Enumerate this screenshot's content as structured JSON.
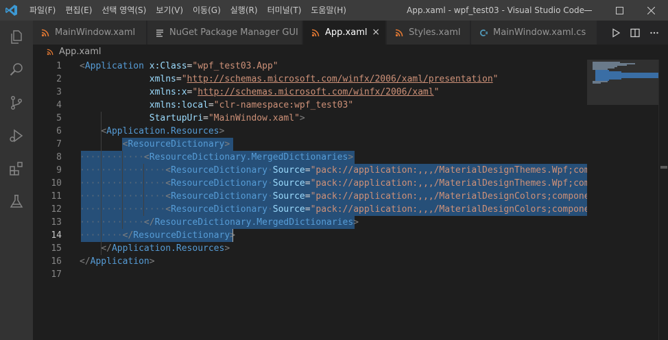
{
  "window": {
    "menu": [
      "파일(F)",
      "편집(E)",
      "선택 영역(S)",
      "보기(V)",
      "이동(G)",
      "실행(R)",
      "터미널(T)",
      "도움말(H)"
    ],
    "title": "App.xaml - wpf_test03 - Visual Studio Code"
  },
  "tabs": [
    {
      "label": "MainWindow.xaml",
      "icon": "rss-xml-icon",
      "color": "#e37933"
    },
    {
      "label": "NuGet Package Manager GUI",
      "icon": "lines-icon",
      "color": "#cccccc"
    },
    {
      "label": "App.xaml",
      "icon": "rss-xml-icon",
      "color": "#e37933"
    },
    {
      "label": "Styles.xaml",
      "icon": "rss-xml-icon",
      "color": "#e37933"
    },
    {
      "label": "MainWindow.xaml.cs",
      "icon": "csharp-icon",
      "color": "#519aba"
    }
  ],
  "active_tab_close": "×",
  "breadcrumb": {
    "file": "App.xaml"
  },
  "editor": {
    "active_line": 14,
    "line_numbers": [
      "1",
      "2",
      "3",
      "4",
      "5",
      "6",
      "7",
      "8",
      "9",
      "10",
      "11",
      "12",
      "13",
      "14",
      "15",
      "16",
      "17"
    ],
    "lines": [
      [
        [
          "t-pun",
          "<"
        ],
        [
          "t-tag",
          "Application"
        ],
        [
          "t-txt",
          " "
        ],
        [
          "t-attr",
          "x:Class"
        ],
        [
          "t-txt",
          "="
        ],
        [
          "t-str",
          "\"wpf_test03.App\""
        ]
      ],
      [
        [
          "t-txt",
          "             "
        ],
        [
          "t-attr",
          "xmlns"
        ],
        [
          "t-txt",
          "="
        ],
        [
          "t-str",
          "\""
        ],
        [
          "t-url",
          "http://schemas.microsoft.com/winfx/2006/xaml/presentation"
        ],
        [
          "t-str",
          "\""
        ]
      ],
      [
        [
          "t-txt",
          "             "
        ],
        [
          "t-attr",
          "xmlns:x"
        ],
        [
          "t-txt",
          "="
        ],
        [
          "t-str",
          "\""
        ],
        [
          "t-url",
          "http://schemas.microsoft.com/winfx/2006/xaml"
        ],
        [
          "t-str",
          "\""
        ]
      ],
      [
        [
          "t-txt",
          "             "
        ],
        [
          "t-attr",
          "xmlns:local"
        ],
        [
          "t-txt",
          "="
        ],
        [
          "t-str",
          "\"clr-namespace:wpf_test03\""
        ]
      ],
      [
        [
          "t-txt",
          "             "
        ],
        [
          "t-attr",
          "StartupUri"
        ],
        [
          "t-txt",
          "="
        ],
        [
          "t-str",
          "\"MainWindow.xaml\""
        ],
        [
          "t-pun",
          ">"
        ]
      ],
      [
        [
          "t-txt",
          "    "
        ],
        [
          "t-pun",
          "<"
        ],
        [
          "t-tag",
          "Application.Resources"
        ],
        [
          "t-pun",
          ">"
        ]
      ],
      [
        [
          "t-txt",
          "        "
        ],
        [
          "t-pun",
          "<"
        ],
        [
          "t-tag",
          "ResourceDictionary"
        ],
        [
          "t-pun",
          ">"
        ]
      ],
      [
        [
          "t-ws",
          "············"
        ],
        [
          "t-pun",
          "<"
        ],
        [
          "t-tag",
          "ResourceDictionary.MergedDictionaries"
        ],
        [
          "t-pun",
          ">"
        ]
      ],
      [
        [
          "t-ws",
          "················"
        ],
        [
          "t-pun",
          "<"
        ],
        [
          "t-tag",
          "ResourceDictionary"
        ],
        [
          "t-ws",
          "·"
        ],
        [
          "t-attr",
          "Source"
        ],
        [
          "t-txt",
          "="
        ],
        [
          "t-str",
          "\"pack://application:,,,/MaterialDesignThemes.Wpf;component/Themes/MaterialDesignTheme.Light.xaml\""
        ]
      ],
      [
        [
          "t-ws",
          "················"
        ],
        [
          "t-pun",
          "<"
        ],
        [
          "t-tag",
          "ResourceDictionary"
        ],
        [
          "t-ws",
          "·"
        ],
        [
          "t-attr",
          "Source"
        ],
        [
          "t-txt",
          "="
        ],
        [
          "t-str",
          "\"pack://application:,,,/MaterialDesignThemes.Wpf;component/Themes/MaterialDesignTheme.Defaults.xaml\""
        ]
      ],
      [
        [
          "t-ws",
          "················"
        ],
        [
          "t-pun",
          "<"
        ],
        [
          "t-tag",
          "ResourceDictionary"
        ],
        [
          "t-ws",
          "·"
        ],
        [
          "t-attr",
          "Source"
        ],
        [
          "t-txt",
          "="
        ],
        [
          "t-str",
          "\"pack://application:,,,/MaterialDesignColors;component/Themes/Recommended/Primary/MaterialDesignColor.DeepPurple.xaml\""
        ]
      ],
      [
        [
          "t-ws",
          "················"
        ],
        [
          "t-pun",
          "<"
        ],
        [
          "t-tag",
          "ResourceDictionary"
        ],
        [
          "t-ws",
          "·"
        ],
        [
          "t-attr",
          "Source"
        ],
        [
          "t-txt",
          "="
        ],
        [
          "t-str",
          "\"pack://application:,,,/MaterialDesignColors;component/Themes/Recommended/Accent/MaterialDesignColor.Lime.xaml\""
        ]
      ],
      [
        [
          "t-ws",
          "············"
        ],
        [
          "t-pun",
          "</"
        ],
        [
          "t-tag",
          "ResourceDictionary.MergedDictionaries"
        ],
        [
          "t-pun",
          ">"
        ]
      ],
      [
        [
          "t-ws",
          "········"
        ],
        [
          "t-pun",
          "</"
        ],
        [
          "t-tag",
          "ResourceDictionary"
        ],
        [
          "t-pun",
          ">"
        ]
      ],
      [
        [
          "t-txt",
          "    "
        ],
        [
          "t-pun",
          "</"
        ],
        [
          "t-tag",
          "Application.Resources"
        ],
        [
          "t-pun",
          ">"
        ]
      ],
      [
        [
          "t-pun",
          "</"
        ],
        [
          "t-tag",
          "Application"
        ],
        [
          "t-pun",
          ">"
        ]
      ],
      []
    ]
  },
  "colors": {
    "titlebar": "#3c3c3c",
    "activity_bar": "#333333",
    "editor_bg": "#1e1e1e",
    "selection": "#264f78",
    "xml_file_icon": "#e37933",
    "csharp_icon": "#519aba",
    "vscode_logo": "#3c99d4"
  }
}
